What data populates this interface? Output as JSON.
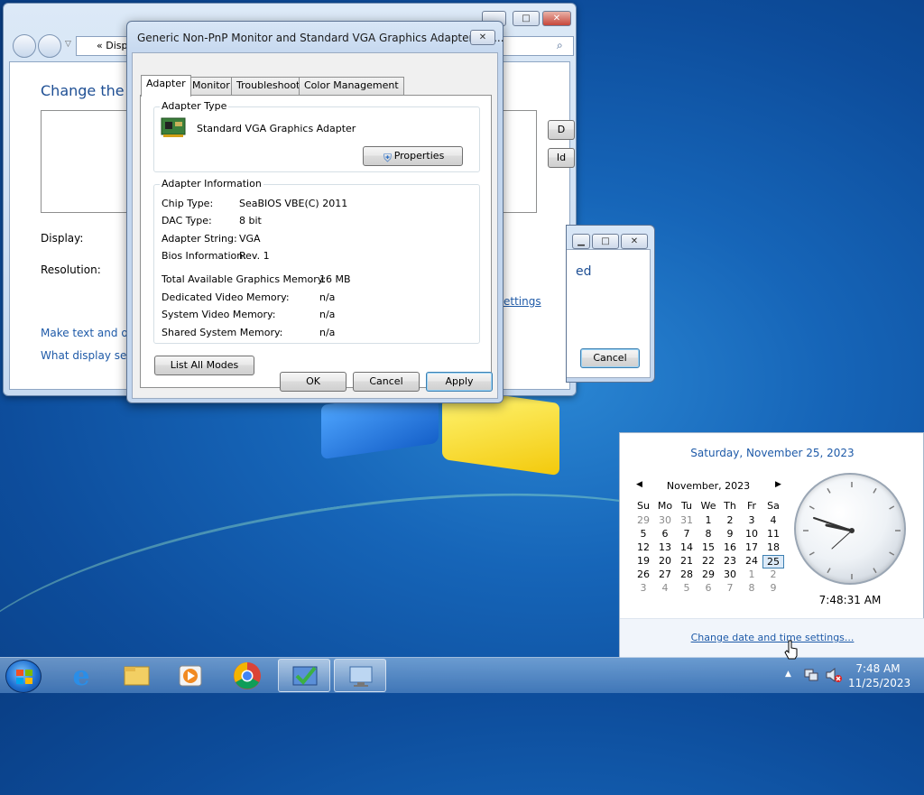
{
  "background_window": {
    "address_text": "«  Disp",
    "heading": "Change the ap",
    "display_label": "Display:",
    "resolution_label": "Resolution:",
    "side_button_1": "D",
    "side_button_2": "Id",
    "link_settings": "ettings",
    "link_text_size": "Make text and oth",
    "link_what_settings": "What display settin"
  },
  "dialog": {
    "title": "Generic Non-PnP Monitor and Standard VGA Graphics Adapter Pro...",
    "tabs": [
      "Adapter",
      "Monitor",
      "Troubleshoot",
      "Color Management"
    ],
    "active_tab": "Adapter",
    "adapter_type": {
      "label": "Adapter Type",
      "name": "Standard VGA Graphics Adapter",
      "properties_button": "Properties"
    },
    "adapter_info": {
      "label": "Adapter Information",
      "rows": [
        {
          "key": "Chip Type:",
          "value": "SeaBIOS VBE(C) 2011"
        },
        {
          "key": "DAC Type:",
          "value": "8 bit"
        },
        {
          "key": "Adapter String:",
          "value": "VGA"
        },
        {
          "key": "Bios Information:",
          "value": "Rev. 1"
        }
      ],
      "memory": [
        {
          "key": "Total Available Graphics Memory:",
          "value": "16 MB"
        },
        {
          "key": "Dedicated Video Memory:",
          "value": "n/a"
        },
        {
          "key": "System Video Memory:",
          "value": "n/a"
        },
        {
          "key": "Shared System Memory:",
          "value": "n/a"
        }
      ]
    },
    "list_all_modes": "List All Modes",
    "ok": "OK",
    "cancel": "Cancel",
    "apply": "Apply"
  },
  "second_dialog": {
    "partial_text": "ed",
    "cancel": "Cancel"
  },
  "flyout": {
    "long_date": "Saturday, November 25, 2023",
    "month_label": "November, 2023",
    "weekdays": [
      "Su",
      "Mo",
      "Tu",
      "We",
      "Th",
      "Fr",
      "Sa"
    ],
    "weeks": [
      [
        "29",
        "30",
        "31",
        "1",
        "2",
        "3",
        "4"
      ],
      [
        "5",
        "6",
        "7",
        "8",
        "9",
        "10",
        "11"
      ],
      [
        "12",
        "13",
        "14",
        "15",
        "16",
        "17",
        "18"
      ],
      [
        "19",
        "20",
        "21",
        "22",
        "23",
        "24",
        "25"
      ],
      [
        "26",
        "27",
        "28",
        "29",
        "30",
        "1",
        "2"
      ],
      [
        "3",
        "4",
        "5",
        "6",
        "7",
        "8",
        "9"
      ]
    ],
    "selected_day": "25",
    "time": "7:48:31 AM",
    "change_settings_link": "Change date and time settings..."
  },
  "taskbar": {
    "items": [
      "start-button",
      "internet-explorer-icon",
      "file-explorer-icon",
      "media-player-icon",
      "chrome-icon",
      "properties-task-icon",
      "display-settings-task-icon"
    ],
    "clock_time": "7:48 AM",
    "clock_date": "11/25/2023"
  },
  "colors": {
    "link": "#1e5aa8",
    "accent_border": "#3c7fb1"
  }
}
